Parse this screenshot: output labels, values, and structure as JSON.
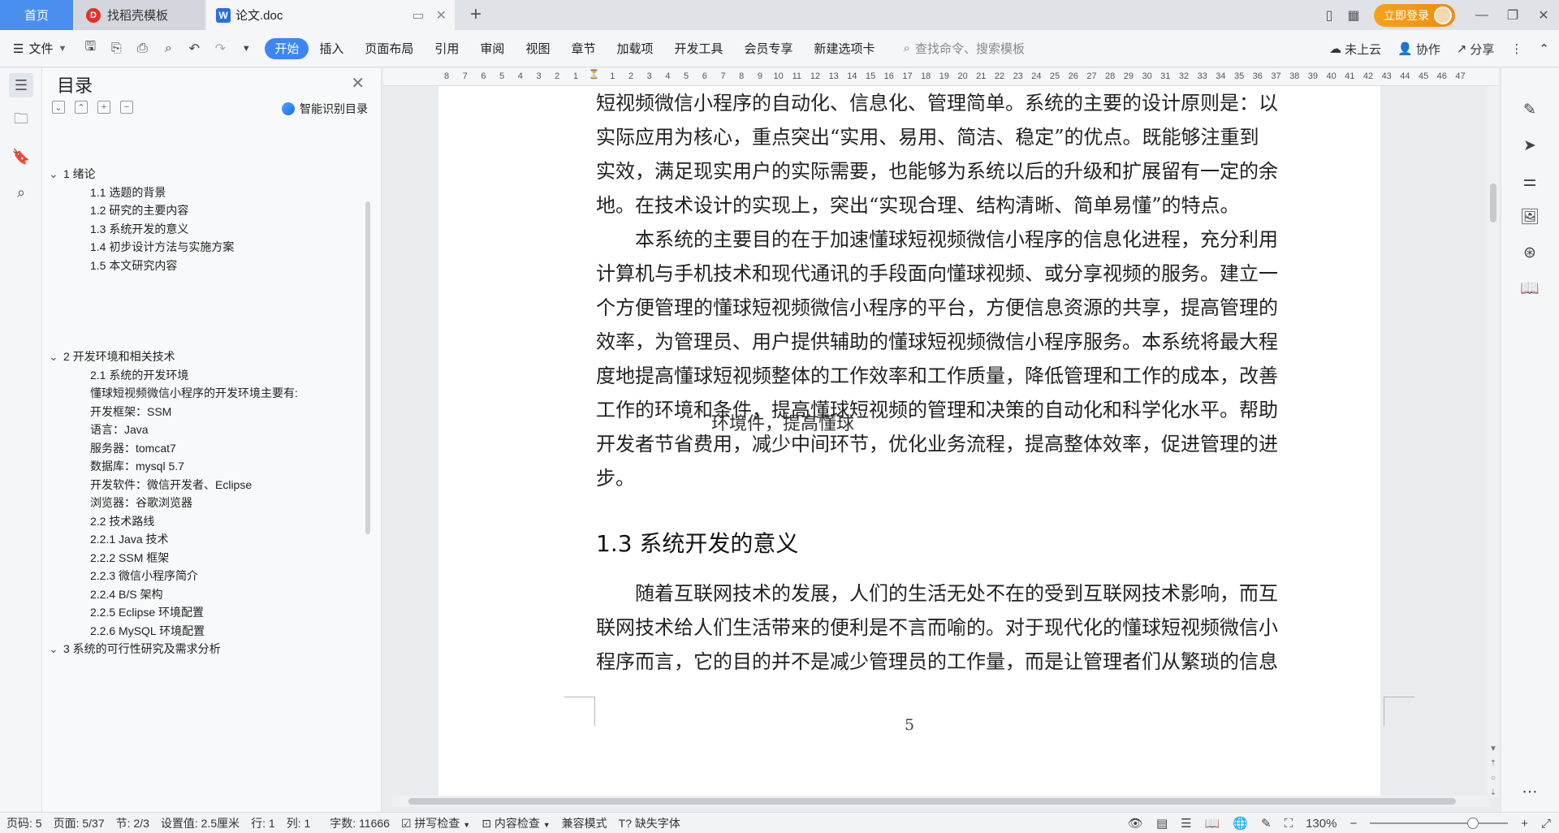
{
  "tabs": {
    "home": "首页",
    "daoke": "找稻壳模板",
    "doc": "论文.doc"
  },
  "titlebar": {
    "login": "立即登录"
  },
  "menu": {
    "file": "文件",
    "items": [
      "开始",
      "插入",
      "页面布局",
      "引用",
      "审阅",
      "视图",
      "章节",
      "加载项",
      "开发工具",
      "会员专享",
      "新建选项卡"
    ],
    "search_placeholder": "查找命令、搜索模板",
    "cloud": "未上云",
    "collab": "协作",
    "share": "分享"
  },
  "toc": {
    "title": "目录",
    "smart": "智能识别目录",
    "items": [
      {
        "level": 1,
        "text": "1 绪论",
        "expanded": true
      },
      {
        "level": 2,
        "text": "1.1 选题的背景"
      },
      {
        "level": 2,
        "text": "1.2  研究的主要内容"
      },
      {
        "level": 2,
        "text": "1.3  系统开发的意义"
      },
      {
        "level": 2,
        "text": "1.4 初步设计方法与实施方案"
      },
      {
        "level": 2,
        "text": "1.5  本文研究内容"
      },
      {
        "level": 1,
        "text": "2 开发环境和相关技术",
        "expanded": true
      },
      {
        "level": 2,
        "text": "2.1 系统的开发环境"
      },
      {
        "level": 2,
        "text": "懂球短视频微信小程序的开发环境主要有:"
      },
      {
        "level": 2,
        "text": "开发框架：SSM"
      },
      {
        "level": 2,
        "text": "语言：Java"
      },
      {
        "level": 2,
        "text": "服务器：tomcat7"
      },
      {
        "level": 2,
        "text": "数据库：mysql 5.7"
      },
      {
        "level": 2,
        "text": "开发软件：微信开发者、Eclipse"
      },
      {
        "level": 2,
        "text": "浏览器：谷歌浏览器"
      },
      {
        "level": 2,
        "text": "2.2 技术路线"
      },
      {
        "level": 2,
        "text": "2.2.1 Java 技术"
      },
      {
        "level": 2,
        "text": "2.2.2 SSM 框架"
      },
      {
        "level": 2,
        "text": "2.2.3 微信小程序简介"
      },
      {
        "level": 2,
        "text": "2.2.4 B/S 架构"
      },
      {
        "level": 2,
        "text": "2.2.5 Eclipse 环境配置"
      },
      {
        "level": 2,
        "text": "2.2.6 MySQL 环境配置"
      },
      {
        "level": 1,
        "text": "3 系统的可行性研究及需求分析",
        "expanded": true
      }
    ]
  },
  "ruler": {
    "labels": [
      "8",
      "7",
      "6",
      "5",
      "4",
      "3",
      "2",
      "1",
      "",
      "1",
      "2",
      "3",
      "4",
      "5",
      "6",
      "7",
      "8",
      "9",
      "10",
      "11",
      "12",
      "13",
      "14",
      "15",
      "16",
      "17",
      "18",
      "19",
      "20",
      "21",
      "22",
      "23",
      "24",
      "25",
      "26",
      "27",
      "28",
      "29",
      "30",
      "31",
      "32",
      "33",
      "34",
      "35",
      "36",
      "37",
      "38",
      "39",
      "40",
      "41",
      "42",
      "43",
      "44",
      "45",
      "46",
      "47"
    ]
  },
  "document": {
    "para1_lines": [
      "短视频微信小程序的自动化、信息化、管理简单。系统的主要的设计原则是：以",
      "实际应用为核心，重点突出“实用、易用、简洁、稳定”的优点。既能够注重到",
      "实效，满足现实用户的实际需要，也能够为系统以后的升级和扩展留有一定的余",
      "地。在技术设计的实现上，突出“实现合理、结构清晰、简单易懂”的特点。"
    ],
    "para2_lines": [
      "　　本系统的主要目的在于加速懂球短视频微信小程序的信息化进程，充分利用",
      "计算机与手机技术和现代通讯的手段面向懂球视频、或分享视频的服务。建立一",
      "个方便管理的懂球短视频微信小程序的平台，方便信息资源的共享，提高管理的",
      "效率，为管理员、用户提供辅助的懂球短视频微信小程序服务。本系统将最大程",
      "度地提高懂球短视频整体的工作效率和工作质量，降低管理和工作的成本，改善",
      "工作的环境和条件，提高懂球短视频的管理和决策的自动化和科学化水平。帮助",
      "开发者节省费用，减少中间环节，优化业务流程，提高整体效率，促进管理的进",
      "步。"
    ],
    "overlay": "环境件，提高懂球",
    "heading": "1.3  系统开发的意义",
    "para3_lines": [
      "　　随着互联网技术的发展，人们的生活无处不在的受到互联网技术影响，而互",
      "联网技术给人们生活带来的便利是不言而喻的。对于现代化的懂球短视频微信小",
      "程序而言，它的目的并不是减少管理员的工作量，而是让管理者们从繁琐的信息"
    ],
    "page_number": "5"
  },
  "status": {
    "page_code": "页码: 5",
    "page": "页面: 5/37",
    "section": "节: 2/3",
    "setting": "设置值: 2.5厘米",
    "row": "行: 1",
    "col": "列: 1",
    "words": "字数: 11666",
    "spell": "拼写检查",
    "content_check": "内容检查",
    "compat": "兼容模式",
    "missing_font": "缺失字体",
    "zoom": "130%"
  },
  "colors": {
    "accent": "#3b86f2",
    "login": "#f39a16",
    "home_tab": "#4a8ff0"
  }
}
